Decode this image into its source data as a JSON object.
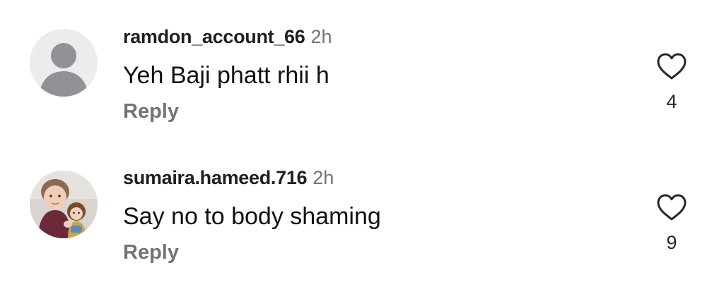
{
  "comments": [
    {
      "username": "ramdon_account_66",
      "time": "2h",
      "text": "Yeh Baji phatt rhii h",
      "reply_label": "Reply",
      "likes": "4",
      "avatar_icon": "default-profile-silhouette"
    },
    {
      "username": "sumaira.hameed.716",
      "time": "2h",
      "text": "Say no to body shaming",
      "reply_label": "Reply",
      "likes": "9",
      "avatar_icon": "profile-photo"
    }
  ],
  "colors": {
    "username": "#1f1f1f",
    "secondary_text": "#737373",
    "body_text": "#111111",
    "heart_outline": "#262626",
    "default_avatar_bg": "#ececee",
    "default_avatar_figure": "#919196"
  }
}
